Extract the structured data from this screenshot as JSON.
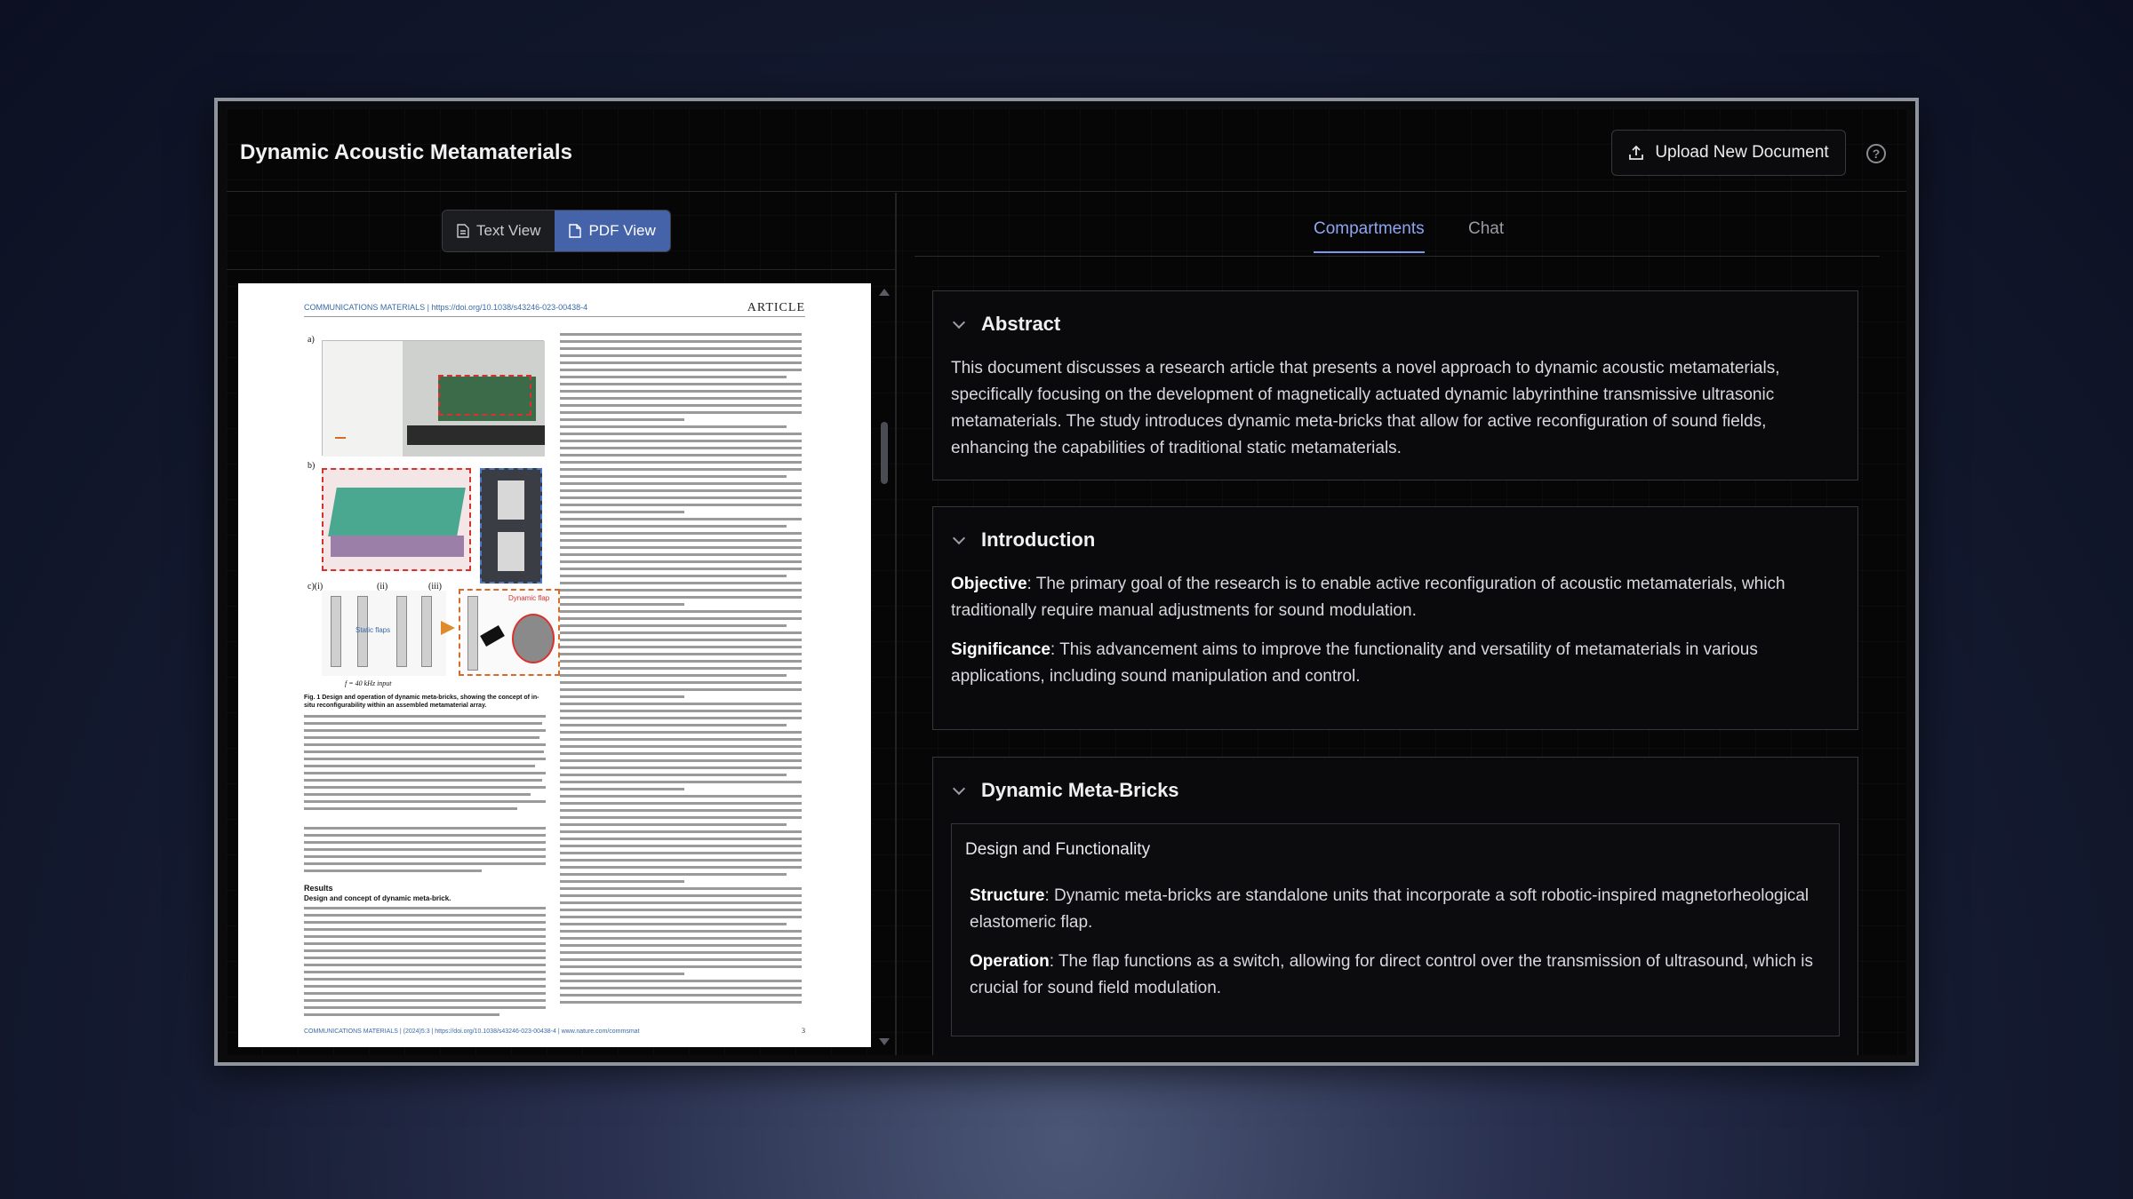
{
  "header": {
    "title": "Dynamic Acoustic Metamaterials",
    "upload_label": "Upload New Document",
    "help_icon": "?"
  },
  "view_toggle": {
    "text_view": "Text View",
    "pdf_view": "PDF View",
    "active": "pdf_view"
  },
  "pdf": {
    "journal": "COMMUNICATIONS MATERIALS | https://doi.org/10.1038/s43246-023-00438-4",
    "article_label": "ARTICLE",
    "fig_labels": [
      "a)",
      "b)",
      "c)(i)",
      "(ii)",
      "(iii)"
    ],
    "dynamic_flap_label": "Dynamic flap",
    "static_flaps_label": "Static flaps",
    "input_label": "f = 40 kHz input",
    "caption_title": "Fig. 1 Design and operation of dynamic meta-bricks, showing the concept of in-situ reconfigurability within an assembled metamaterial array.",
    "results_heading": "Results",
    "subheading": "Design and concept of dynamic meta-brick.",
    "footer": "COMMUNICATIONS MATERIALS | (2024)5:3 | https://doi.org/10.1038/s43246-023-00438-4 | www.nature.com/commsmat",
    "page_number": "3"
  },
  "tabs": {
    "compartments": "Compartments",
    "chat": "Chat",
    "active": "compartments"
  },
  "sections": {
    "abstract": {
      "title": "Abstract",
      "text": "This document discusses a research article that presents a novel approach to dynamic acoustic metamaterials, specifically focusing on the development of magnetically actuated dynamic labyrinthine transmissive ultrasonic metamaterials. The study introduces dynamic meta-bricks that allow for active reconfiguration of sound fields, enhancing the capabilities of traditional static metamaterials."
    },
    "introduction": {
      "title": "Introduction",
      "objective_label": "Objective",
      "objective_text": ": The primary goal of the research is to enable active reconfiguration of acoustic metamaterials, which traditionally require manual adjustments for sound modulation.",
      "significance_label": "Significance",
      "significance_text": ": This advancement aims to improve the functionality and versatility of metamaterials in various applications, including sound manipulation and control."
    },
    "meta_bricks": {
      "title": "Dynamic Meta-Bricks",
      "sub_title": "Design and Functionality",
      "structure_label": "Structure",
      "structure_text": ": Dynamic meta-bricks are standalone units that incorporate a soft robotic-inspired magnetorheological elastomeric flap.",
      "operation_label": "Operation",
      "operation_text": ": The flap functions as a switch, allowing for direct control over the transmission of ultrasound, which is crucial for sound field modulation."
    }
  },
  "colors": {
    "accent": "#4563a8",
    "tab_active": "#8ea5f2"
  }
}
